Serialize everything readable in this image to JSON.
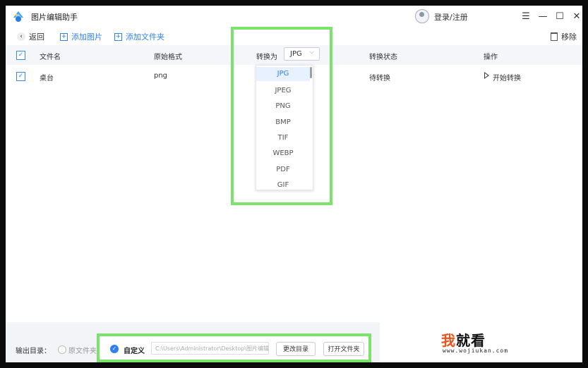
{
  "app": {
    "title": "图片编辑助手"
  },
  "header": {
    "login_label": "登录/注册"
  },
  "window_controls": {
    "menu": "☰",
    "minimize": "—",
    "maximize": "☐",
    "close": "✕"
  },
  "toolbar": {
    "back_label": "返回",
    "add_image_label": "添加图片",
    "add_folder_label": "添加文件夹",
    "remove_label": "移除"
  },
  "table": {
    "columns": [
      "文件名",
      "原始格式",
      "转换为",
      "转换状态",
      "操作"
    ],
    "convert_select_value": "JPG",
    "rows": [
      {
        "name": "桌台",
        "format": "png",
        "status": "待转换",
        "action": "开始转换"
      }
    ]
  },
  "format_dropdown": {
    "options": [
      "JPG",
      "JPEG",
      "PNG",
      "BMP",
      "TIF",
      "WEBP",
      "PDF",
      "GIF"
    ],
    "selected": "JPG"
  },
  "output": {
    "label": "输出目录：",
    "original_folder_label": "原文件夹",
    "custom_label": "自定义",
    "path_value": "C:\\Users\\Administrator\\Desktop\\图片编辑",
    "change_dir_label": "更改目录",
    "open_folder_label": "打开文件夹"
  },
  "watermark": {
    "brand_red": "我",
    "brand_black": "就看",
    "url": "www.wojiukan.com"
  },
  "colors": {
    "accent": "#2f7ff0",
    "highlight": "#7be36a",
    "header_bg": "#f4f6f9"
  }
}
